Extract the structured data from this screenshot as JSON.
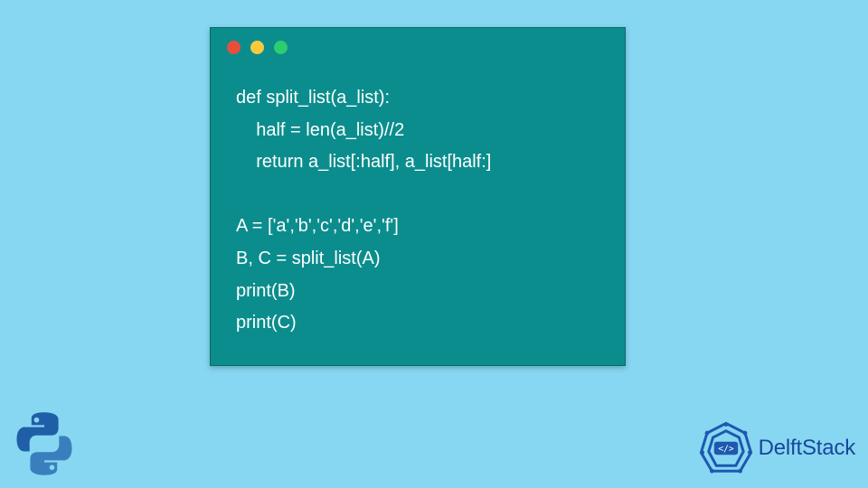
{
  "window": {
    "dots": [
      "red",
      "yellow",
      "green"
    ]
  },
  "code": {
    "lines": [
      "def split_list(a_list):",
      "    half = len(a_list)//2",
      "    return a_list[:half], a_list[half:]",
      "",
      "A = ['a','b','c','d','e','f']",
      "B, C = split_list(A)",
      "print(B)",
      "print(C)"
    ]
  },
  "logos": {
    "python": "python-logo",
    "brand_name": "DelftStack"
  },
  "colors": {
    "bg": "#87d7f2",
    "window_bg": "#0b8d8d",
    "code_text": "#ffffff",
    "brand_text": "#19479b"
  }
}
